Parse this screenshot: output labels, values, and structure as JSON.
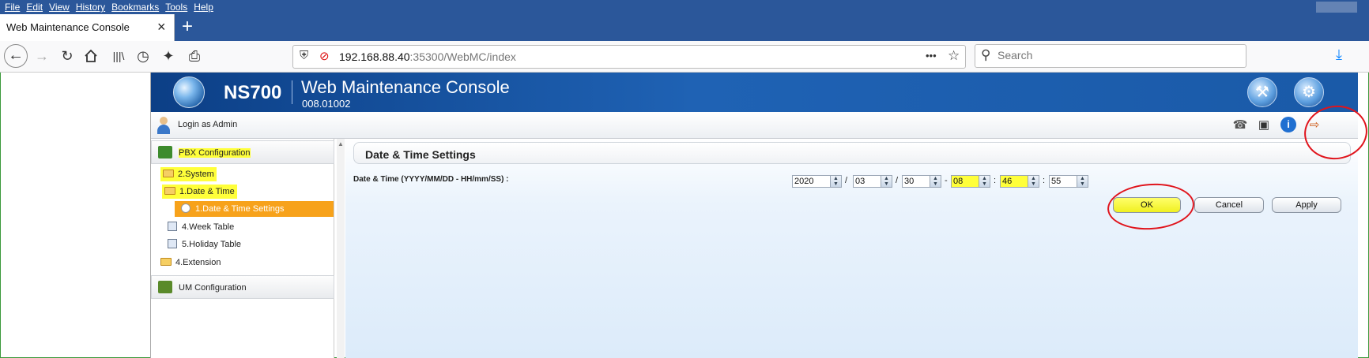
{
  "browser": {
    "menu": [
      "File",
      "Edit",
      "View",
      "History",
      "Bookmarks",
      "Tools",
      "Help"
    ],
    "tab_title": "Web Maintenance Console",
    "tab_close": "×",
    "new_tab": "+",
    "url_host": "192.168.88.40",
    "url_rest": ":35300/WebMC/index",
    "url_dots": "•••",
    "search_placeholder": "Search"
  },
  "app": {
    "brand": "NS700",
    "title": "Web Maintenance Console",
    "version": "008.01002",
    "login_text": "Login as Admin"
  },
  "sidebar": {
    "sections": [
      {
        "label": "PBX Configuration",
        "icon": "pbx-config-icon"
      },
      {
        "label": "UM Configuration",
        "icon": "um-config-icon"
      }
    ],
    "tree": [
      {
        "label": "2.System",
        "type": "folder",
        "highlighted": true
      },
      {
        "label": "1.Date & Time",
        "type": "folder",
        "highlighted": true
      },
      {
        "label": "1.Date & Time Settings",
        "type": "page",
        "selected": true
      },
      {
        "label": "4.Week Table",
        "type": "page"
      },
      {
        "label": "5.Holiday Table",
        "type": "page"
      },
      {
        "label": "4.Extension",
        "type": "folder"
      }
    ]
  },
  "main": {
    "panel_title": "Date & Time Settings",
    "field_label": "Date & Time (YYYY/MM/DD - HH/mm/SS) :",
    "datetime": {
      "year": "2020",
      "month": "03",
      "day": "30",
      "hour": "08",
      "minute": "46",
      "second": "55"
    },
    "separators": [
      "/",
      "/",
      "-",
      ":",
      ":"
    ],
    "buttons": {
      "ok": "OK",
      "cancel": "Cancel",
      "apply": "Apply"
    }
  },
  "colors": {
    "menu_bar": "#2b579a",
    "banner": "#1f62b4",
    "selected_item": "#f7a21b",
    "highlight": "#ffff3a",
    "annotation": "#e0141c"
  }
}
